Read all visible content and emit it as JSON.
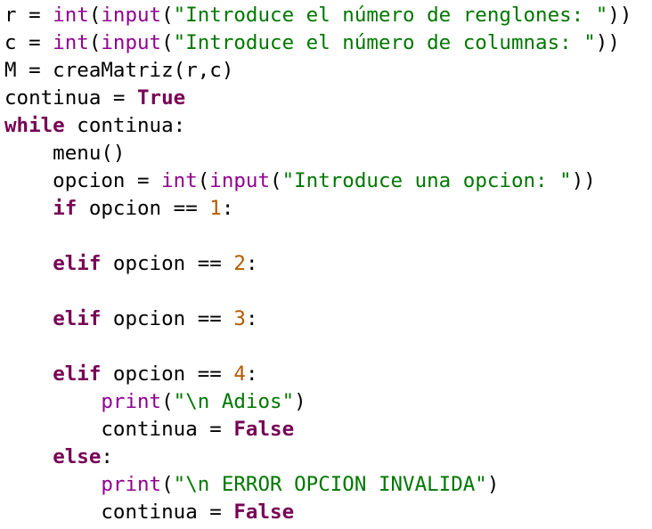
{
  "code": {
    "lines": [
      [
        {
          "t": "r = ",
          "c": "pl"
        },
        {
          "t": "int",
          "c": "bi"
        },
        {
          "t": "(",
          "c": "pl"
        },
        {
          "t": "input",
          "c": "bi"
        },
        {
          "t": "(",
          "c": "pl"
        },
        {
          "t": "\"Introduce el número de renglones: \"",
          "c": "st"
        },
        {
          "t": "))",
          "c": "pl"
        }
      ],
      [
        {
          "t": "c = ",
          "c": "pl"
        },
        {
          "t": "int",
          "c": "bi"
        },
        {
          "t": "(",
          "c": "pl"
        },
        {
          "t": "input",
          "c": "bi"
        },
        {
          "t": "(",
          "c": "pl"
        },
        {
          "t": "\"Introduce el número de columnas: \"",
          "c": "st"
        },
        {
          "t": "))",
          "c": "pl"
        }
      ],
      [
        {
          "t": "M = creaMatriz(r,c)",
          "c": "pl"
        }
      ],
      [
        {
          "t": "continua = ",
          "c": "pl"
        },
        {
          "t": "True",
          "c": "kw"
        }
      ],
      [
        {
          "t": "while",
          "c": "kw"
        },
        {
          "t": " continua:",
          "c": "pl"
        }
      ],
      [
        {
          "t": "    menu()",
          "c": "pl"
        }
      ],
      [
        {
          "t": "    opcion = ",
          "c": "pl"
        },
        {
          "t": "int",
          "c": "bi"
        },
        {
          "t": "(",
          "c": "pl"
        },
        {
          "t": "input",
          "c": "bi"
        },
        {
          "t": "(",
          "c": "pl"
        },
        {
          "t": "\"Introduce una opcion: \"",
          "c": "st"
        },
        {
          "t": "))",
          "c": "pl"
        }
      ],
      [
        {
          "t": "    ",
          "c": "pl"
        },
        {
          "t": "if",
          "c": "kw"
        },
        {
          "t": " opcion == ",
          "c": "pl"
        },
        {
          "t": "1",
          "c": "nm"
        },
        {
          "t": ":",
          "c": "pl"
        }
      ],
      [],
      [
        {
          "t": "    ",
          "c": "pl"
        },
        {
          "t": "elif",
          "c": "kw"
        },
        {
          "t": " opcion == ",
          "c": "pl"
        },
        {
          "t": "2",
          "c": "nm"
        },
        {
          "t": ":",
          "c": "pl"
        }
      ],
      [],
      [
        {
          "t": "    ",
          "c": "pl"
        },
        {
          "t": "elif",
          "c": "kw"
        },
        {
          "t": " opcion == ",
          "c": "pl"
        },
        {
          "t": "3",
          "c": "nm"
        },
        {
          "t": ":",
          "c": "pl"
        }
      ],
      [],
      [
        {
          "t": "    ",
          "c": "pl"
        },
        {
          "t": "elif",
          "c": "kw"
        },
        {
          "t": " opcion == ",
          "c": "pl"
        },
        {
          "t": "4",
          "c": "nm"
        },
        {
          "t": ":",
          "c": "pl"
        }
      ],
      [
        {
          "t": "        ",
          "c": "pl"
        },
        {
          "t": "print",
          "c": "bi"
        },
        {
          "t": "(",
          "c": "pl"
        },
        {
          "t": "\"\\n Adios\"",
          "c": "st"
        },
        {
          "t": ")",
          "c": "pl"
        }
      ],
      [
        {
          "t": "        continua = ",
          "c": "pl"
        },
        {
          "t": "False",
          "c": "kw"
        }
      ],
      [
        {
          "t": "    ",
          "c": "pl"
        },
        {
          "t": "else",
          "c": "kw"
        },
        {
          "t": ":",
          "c": "pl"
        }
      ],
      [
        {
          "t": "        ",
          "c": "pl"
        },
        {
          "t": "print",
          "c": "bi"
        },
        {
          "t": "(",
          "c": "pl"
        },
        {
          "t": "\"\\n ERROR OPCION INVALIDA\"",
          "c": "st"
        },
        {
          "t": ")",
          "c": "pl"
        }
      ],
      [
        {
          "t": "        continua = ",
          "c": "pl"
        },
        {
          "t": "False",
          "c": "kw"
        }
      ]
    ]
  },
  "colors": {
    "background": "#ffffff",
    "keyword": "#770055",
    "builtin": "#900090",
    "string": "#007700",
    "number": "#b55a00",
    "plain": "#000000"
  }
}
